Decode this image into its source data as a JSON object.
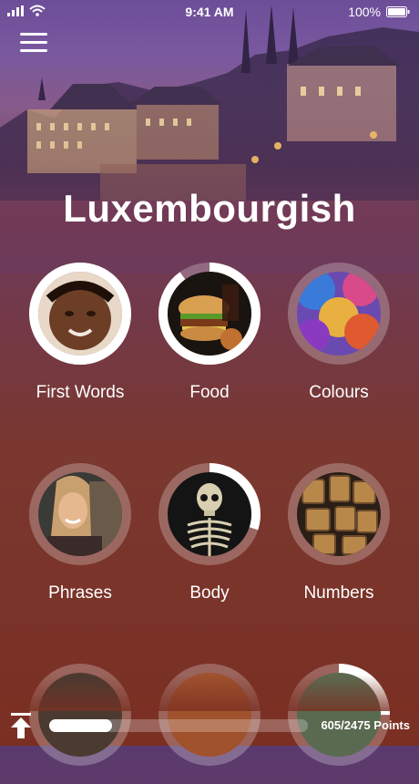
{
  "status_bar": {
    "time": "9:41 AM",
    "battery": "100%"
  },
  "title": "Luxembourgish",
  "categories": [
    {
      "label": "First Words",
      "progress": 1.0
    },
    {
      "label": "Food",
      "progress": 0.9
    },
    {
      "label": "Colours",
      "progress": 0.0
    },
    {
      "label": "Phrases",
      "progress": 0.0
    },
    {
      "label": "Body",
      "progress": 0.3
    },
    {
      "label": "Numbers",
      "progress": 0.0
    },
    {
      "label": "",
      "progress": 0.0
    },
    {
      "label": "",
      "progress": 0.0
    },
    {
      "label": "",
      "progress": 0.25
    }
  ],
  "footer": {
    "points": "605/2475 Points",
    "progress": 0.244
  },
  "colors": {
    "ring_fill": "#ffffff",
    "ring_track": "rgba(255,255,255,0.25)"
  }
}
